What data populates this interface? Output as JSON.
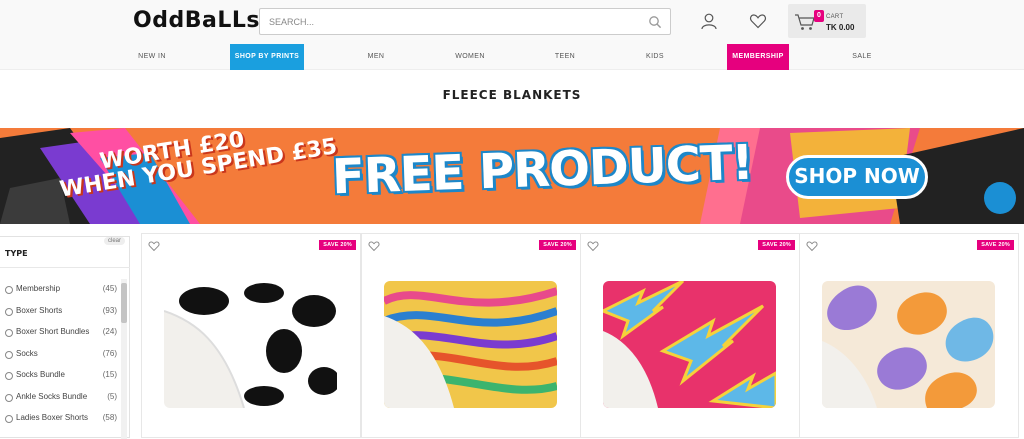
{
  "brand": {
    "logo_text": "OddBaLLs"
  },
  "search": {
    "placeholder": "SEARCH..."
  },
  "cart": {
    "count": "0",
    "label": "CART",
    "total": "TK 0.00"
  },
  "nav": {
    "items": [
      {
        "label": "NEW IN",
        "style": "plain"
      },
      {
        "label": "SHOP BY PRINTS",
        "style": "blue"
      },
      {
        "label": "MEN",
        "style": "plain"
      },
      {
        "label": "WOMEN",
        "style": "plain"
      },
      {
        "label": "TEEN",
        "style": "plain"
      },
      {
        "label": "KIDS",
        "style": "plain"
      },
      {
        "label": "MEMBERSHIP",
        "style": "pink"
      },
      {
        "label": "SALE",
        "style": "plain"
      }
    ]
  },
  "page": {
    "title": "FLEECE BLANKETS"
  },
  "banner": {
    "line1": "WORTH £20",
    "line2": "WHEN YOU SPEND £35",
    "headline": "FREE PRODUCT!",
    "cta": "SHOP NOW"
  },
  "filter": {
    "title": "TYPE",
    "clear": "clear",
    "options": [
      {
        "label": "Membership",
        "count": "(45)"
      },
      {
        "label": "Boxer Shorts",
        "count": "(93)"
      },
      {
        "label": "Boxer Short Bundles",
        "count": "(24)"
      },
      {
        "label": "Socks",
        "count": "(76)"
      },
      {
        "label": "Socks Bundle",
        "count": "(15)"
      },
      {
        "label": "Ankle Socks Bundle",
        "count": "(5)"
      },
      {
        "label": "Ladies Boxer Shorts",
        "count": "(58)"
      }
    ]
  },
  "products": [
    {
      "badge": "SAVE 20%",
      "pattern": "cow-print"
    },
    {
      "badge": "SAVE 20%",
      "pattern": "psychedelic-swirl"
    },
    {
      "badge": "SAVE 20%",
      "pattern": "lightning-bolts"
    },
    {
      "badge": "SAVE 20%",
      "pattern": "retro-flower"
    }
  ],
  "colors": {
    "blue": "#1a9fdf",
    "pink": "#e6007e",
    "orange": "#f47b3a"
  }
}
